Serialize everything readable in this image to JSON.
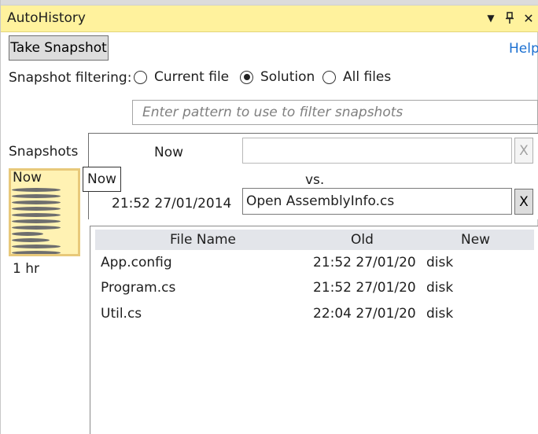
{
  "window": {
    "title": "AutoHistory",
    "controls": {
      "dropdown": "▼",
      "pin": "📌",
      "close": "✕"
    }
  },
  "toolbar": {
    "take_snapshot_label": "Take Snapshot",
    "help_label": "Help"
  },
  "filtering": {
    "label": "Snapshot filtering:",
    "options": [
      {
        "label": "Current file",
        "checked": false
      },
      {
        "label": "Solution",
        "checked": true
      },
      {
        "label": "All files",
        "checked": false
      }
    ]
  },
  "filter_input": {
    "value": "",
    "placeholder": "Enter pattern to use to filter snapshots"
  },
  "snapshots": {
    "label": "Snapshots",
    "timeline_top_label": "Now",
    "timeline_bottom_label": "1 hr",
    "tooltip": "Now"
  },
  "compare": {
    "left_label": "Now",
    "left_value": "",
    "vs_label": "vs.",
    "right_label": "21:52 27/01/2014",
    "right_value": "Open AssemblyInfo.cs",
    "clear_label": "X"
  },
  "files": {
    "columns": [
      "File Name",
      "Old",
      "New"
    ],
    "rows": [
      {
        "name": "App.config",
        "old": "21:52 27/01/20",
        "new": "disk"
      },
      {
        "name": "Program.cs",
        "old": "21:52 27/01/20",
        "new": "disk"
      },
      {
        "name": "Util.cs",
        "old": "22:04 27/01/20",
        "new": "disk"
      }
    ]
  },
  "colors": {
    "title_bar": "#fff29d",
    "timeline_fill": "#fff2b3",
    "link": "#1a6fd1"
  }
}
